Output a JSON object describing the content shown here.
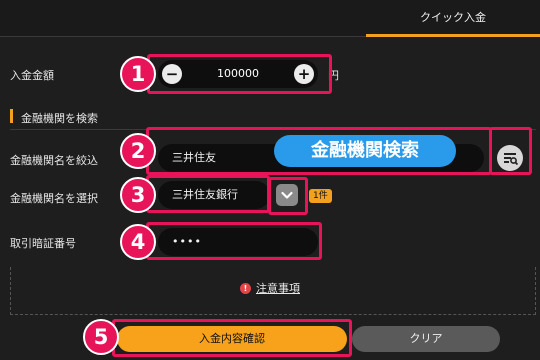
{
  "tabs": {
    "active_label": "クイック入金"
  },
  "amount": {
    "label": "入金金額",
    "value": "100000",
    "unit": "円",
    "minus": "−",
    "plus": "+"
  },
  "bank_section": {
    "title": "金融機関を検索"
  },
  "bank_filter": {
    "label": "金融機関名を絞込",
    "value": "三井住友"
  },
  "bank_select": {
    "label": "金融機関名を選択",
    "value": "三井住友銀行",
    "count_badge": "1件"
  },
  "pin": {
    "label": "取引暗証番号",
    "value": "••••"
  },
  "notice": {
    "info_glyph": "!",
    "link_text": "注意事項"
  },
  "buttons": {
    "confirm_label": "入金内容確認",
    "clear_label": "クリア"
  },
  "annotations": {
    "callout_search": "金融機関検索",
    "markers": [
      "1",
      "2",
      "3",
      "4",
      "5"
    ],
    "highlight_color": "#e8145a",
    "callout_color": "#2a9bea"
  },
  "colors": {
    "accent": "#f2a11e",
    "background": "#1e1e1f"
  }
}
